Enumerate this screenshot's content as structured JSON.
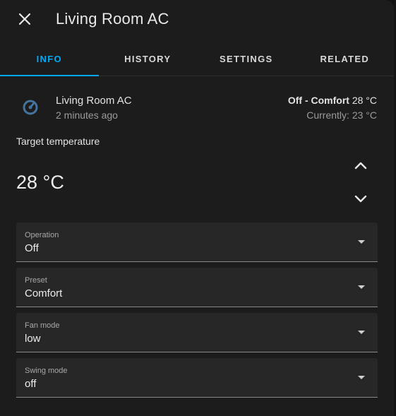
{
  "dialog": {
    "title": "Living Room AC",
    "close_icon": "close-icon"
  },
  "tabs": [
    {
      "label": "INFO",
      "active": true
    },
    {
      "label": "HISTORY",
      "active": false
    },
    {
      "label": "SETTINGS",
      "active": false
    },
    {
      "label": "RELATED",
      "active": false
    }
  ],
  "entity": {
    "icon": "thermostat-icon",
    "name": "Living Room AC",
    "last_changed": "2 minutes ago",
    "state_mode": "Off - Comfort",
    "state_temp": "28 °C",
    "current": "Currently: 23 °C"
  },
  "target": {
    "label": "Target temperature",
    "value": "28 °C",
    "up_icon": "chevron-up-icon",
    "down_icon": "chevron-down-icon"
  },
  "selects": [
    {
      "label": "Operation",
      "value": "Off"
    },
    {
      "label": "Preset",
      "value": "Comfort"
    },
    {
      "label": "Fan mode",
      "value": "low"
    },
    {
      "label": "Swing mode",
      "value": "off"
    }
  ],
  "colors": {
    "accent": "#03a9f4",
    "icon": "#44739e",
    "background": "#1c1c1c"
  }
}
